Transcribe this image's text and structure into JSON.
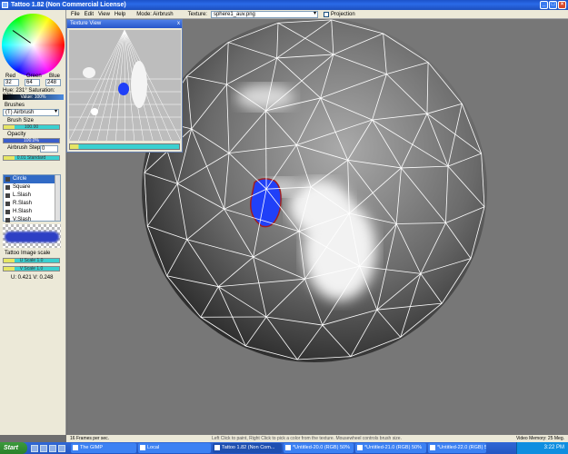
{
  "window": {
    "title": "Tattoo 1.82 (Non Commercial License)"
  },
  "menu": {
    "items": [
      "File",
      "Edit",
      "View",
      "Help"
    ],
    "mode": "Mode: Airbrush",
    "texture_label": "Texture:",
    "texture_value": "sphere1_auv.png",
    "projection_label": "Projection"
  },
  "color": {
    "red_label": "Red",
    "green_label": "Green",
    "blue_label": "Blue",
    "red": "32",
    "green": "64",
    "blue": "248",
    "hue_sat": "Hue: 231°  Saturation: 87%",
    "value": "Value: 100%"
  },
  "brushes": {
    "label": "Brushes",
    "selected": "(T) Airbrush",
    "size_label": "Brush Size",
    "size_value": "100.00",
    "opacity_label": "Opacity",
    "opacity_value": "100.0%",
    "step_label": "Airbrush Step",
    "step_value": "0",
    "step_bar": "0.01 Standard",
    "list": [
      "Circle",
      "Square",
      "L.Slash",
      "R.Slash",
      "H.Slash",
      "V.Slash"
    ]
  },
  "scale": {
    "label": "Tattoo Image scale",
    "u_scale": "U Scale 1.0",
    "v_scale": "V Scale 1.0",
    "uv": "U: 0.421  V: 0.248"
  },
  "texture_view": {
    "title": "Texture View",
    "close": "x"
  },
  "status": {
    "fps": "16 Frames per sec.",
    "hint": "Left Click to paint, Right Click to pick a color from the texture. Mousewheel controls brush size.",
    "memory": "Video Memory: 25 Meg."
  },
  "taskbar": {
    "start": "Start",
    "buttons": [
      "The GIMP",
      "Local",
      "Tattoo 1.82 (Non Com...",
      "*Untitled-20.0 (RGB) 50%",
      "*Untitled-21.0 (RGB) 50%",
      "*Untitled-22.0 (RGB) 50%"
    ],
    "active_index": 2,
    "clock": "3:22 PM"
  },
  "colors": {
    "paint_blue": "#2040f8",
    "titlebar": "#2a6ae8"
  }
}
